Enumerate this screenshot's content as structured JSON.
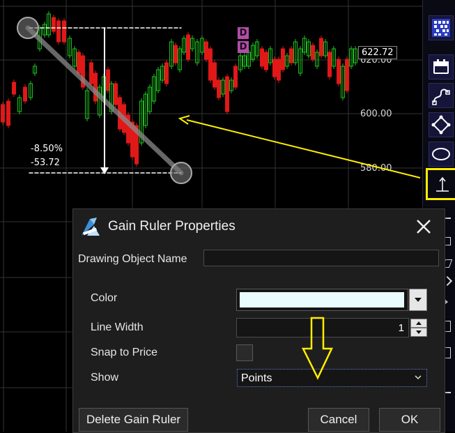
{
  "chart": {
    "price_labels": [
      "620.00",
      "600.00",
      "580.00"
    ],
    "last_price": "622.72",
    "ruler": {
      "percent": "-8.50%",
      "points": "-53.72"
    },
    "markers": [
      "D",
      "D"
    ],
    "colors": {
      "up": "#1fbf1f",
      "down": "#e01818",
      "grid": "#333333",
      "ruler": "#ffffff",
      "annotation": "#ffee00"
    }
  },
  "toolbar": {
    "tools": [
      {
        "icon": "grid-icon"
      },
      {
        "icon": "calendar-icon"
      },
      {
        "icon": "curve-draw-icon"
      },
      {
        "icon": "diamond-icon"
      },
      {
        "icon": "ellipse-icon"
      },
      {
        "icon": "gain-ruler-icon",
        "highlighted": true
      }
    ]
  },
  "dialog": {
    "title": "Gain Ruler Properties",
    "drawing_object_name_label": "Drawing Object Name",
    "drawing_object_name_value": "",
    "color_label": "Color",
    "color_value": "#e9fdff",
    "line_width_label": "Line Width",
    "line_width_value": "1",
    "snap_label": "Snap to Price",
    "snap_checked": false,
    "show_label": "Show",
    "show_value": "Points",
    "delete_button": "Delete Gain Ruler",
    "cancel_button": "Cancel",
    "ok_button": "OK"
  }
}
